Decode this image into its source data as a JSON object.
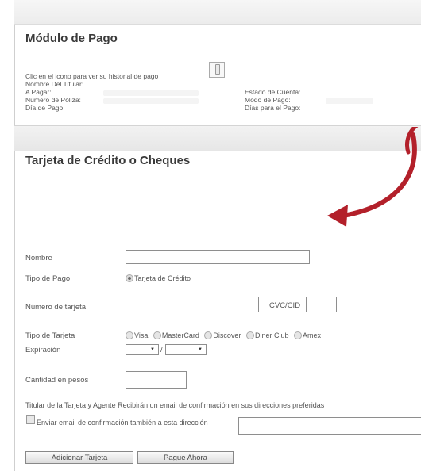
{
  "payment_module": {
    "title": "Módulo de Pago",
    "history_prompt": "Clic en el icono para ver su historial de pago",
    "holder_label": "Nombre Del Titular:",
    "to_pay_label": "A Pagar:",
    "account_status_label": "Estado de Cuenta:",
    "policy_number_label": "Número de Póliza:",
    "payment_mode_label": "Modo de Pago:",
    "payment_day_label": "Día de Pago:",
    "days_to_pay_label": "Días para el Pago:"
  },
  "card_section": {
    "title": "Tarjeta de Crédito o Cheques",
    "name_label": "Nombre",
    "name_value": "",
    "payment_type_label": "Tipo de Pago",
    "payment_type_option": "Tarjeta de Crédito",
    "card_number_label": "Número de tarjeta",
    "card_number_value": "",
    "cvc_label": "CVC/CID",
    "card_type_label": "Tipo de Tarjeta",
    "card_types": [
      "Visa",
      "MasterCard",
      "Discover",
      "Diner Club",
      "Amex"
    ],
    "expiration_label": "Expiración",
    "exp_separator": "/",
    "amount_label": "Cantidad en pesos",
    "amount_value": "",
    "confirmation_note": "Titular de la Tarjeta y Agente Recibirán un email de confirmación en sus direcciones preferidas",
    "send_email_label": "Enviar email de confirmación también a esta dirección",
    "add_card_button": "Adicionar Tarjeta",
    "pay_now_button": "Pague Ahora"
  },
  "colors": {
    "annotation_arrow": "#b3202a"
  }
}
